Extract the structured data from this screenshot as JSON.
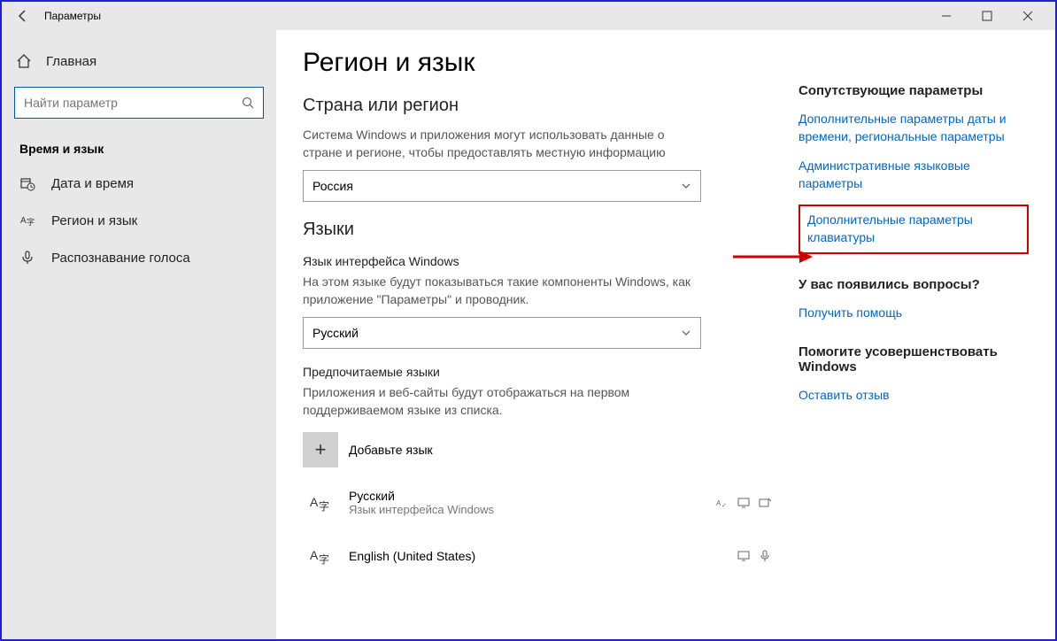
{
  "titlebar": {
    "title": "Параметры"
  },
  "sidebar": {
    "home": "Главная",
    "search_placeholder": "Найти параметр",
    "section": "Время и язык",
    "items": [
      {
        "label": "Дата и время"
      },
      {
        "label": "Регион и язык"
      },
      {
        "label": "Распознавание голоса"
      }
    ]
  },
  "main": {
    "title": "Регион и язык",
    "region_h": "Страна или регион",
    "region_desc": "Система Windows и приложения могут использовать данные о стране и регионе, чтобы предоставлять местную информацию",
    "region_value": "Россия",
    "lang_h": "Языки",
    "display_lang_label": "Язык интерфейса Windows",
    "display_lang_desc": "На этом языке будут показываться такие компоненты Windows, как приложение \"Параметры\" и проводник.",
    "display_lang_value": "Русский",
    "pref_h": "Предпочитаемые языки",
    "pref_desc": "Приложения и веб-сайты будут отображаться на первом поддерживаемом языке из списка.",
    "add_lang": "Добавьте язык",
    "languages": [
      {
        "name": "Русский",
        "sub": "Язык интерфейса Windows"
      },
      {
        "name": "English (United States)",
        "sub": ""
      }
    ]
  },
  "rightpane": {
    "related_h": "Сопутствующие параметры",
    "related_links": [
      "Дополнительные параметры даты и времени, региональные параметры",
      "Административные языковые параметры",
      "Дополнительные параметры клавиатуры"
    ],
    "questions_h": "У вас появились вопросы?",
    "help_link": "Получить помощь",
    "improve_h": "Помогите усовершенствовать Windows",
    "feedback_link": "Оставить отзыв"
  }
}
